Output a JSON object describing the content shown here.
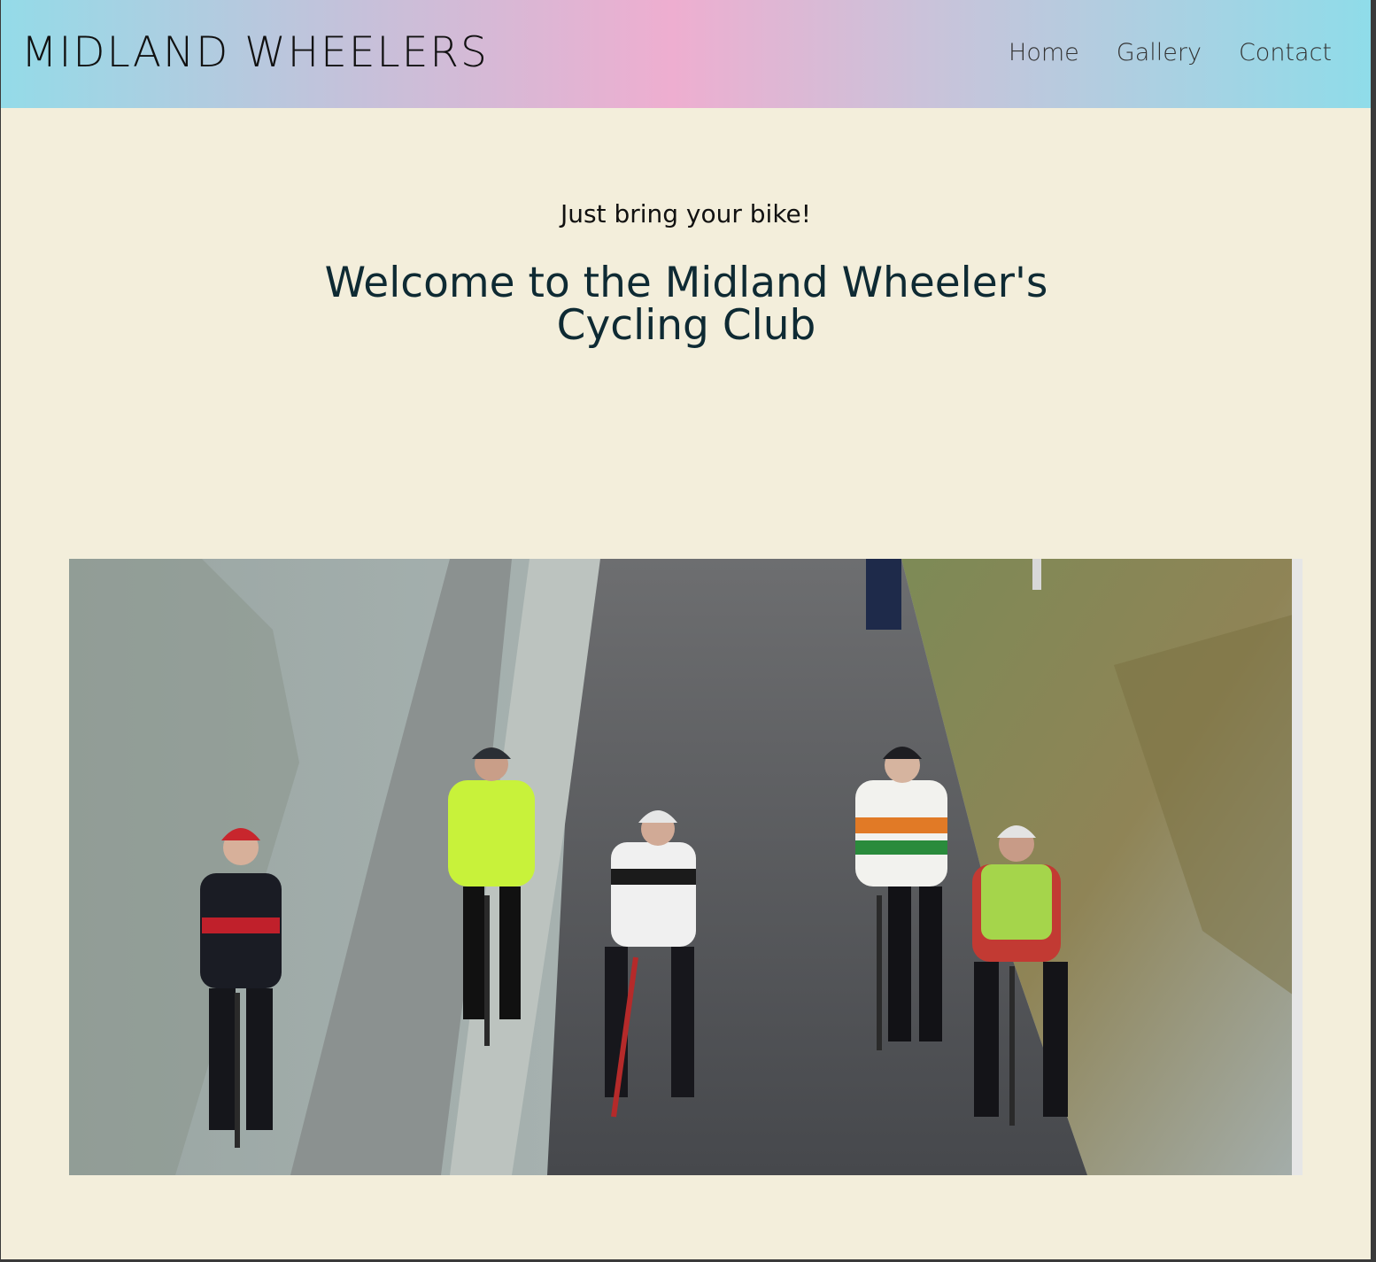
{
  "header": {
    "brand": "MIDLAND WHEELERS",
    "nav": [
      {
        "label": "Home"
      },
      {
        "label": "Gallery"
      },
      {
        "label": "Contact"
      }
    ]
  },
  "hero": {
    "tagline": "Just bring your bike!",
    "title": "Welcome to the Midland Wheeler's Cycling Club"
  },
  "colors": {
    "background": "#f3eedb",
    "title": "#0e2a33",
    "header_gradient": [
      "#94dbe8",
      "#eeaed0",
      "#8fdce9"
    ]
  }
}
